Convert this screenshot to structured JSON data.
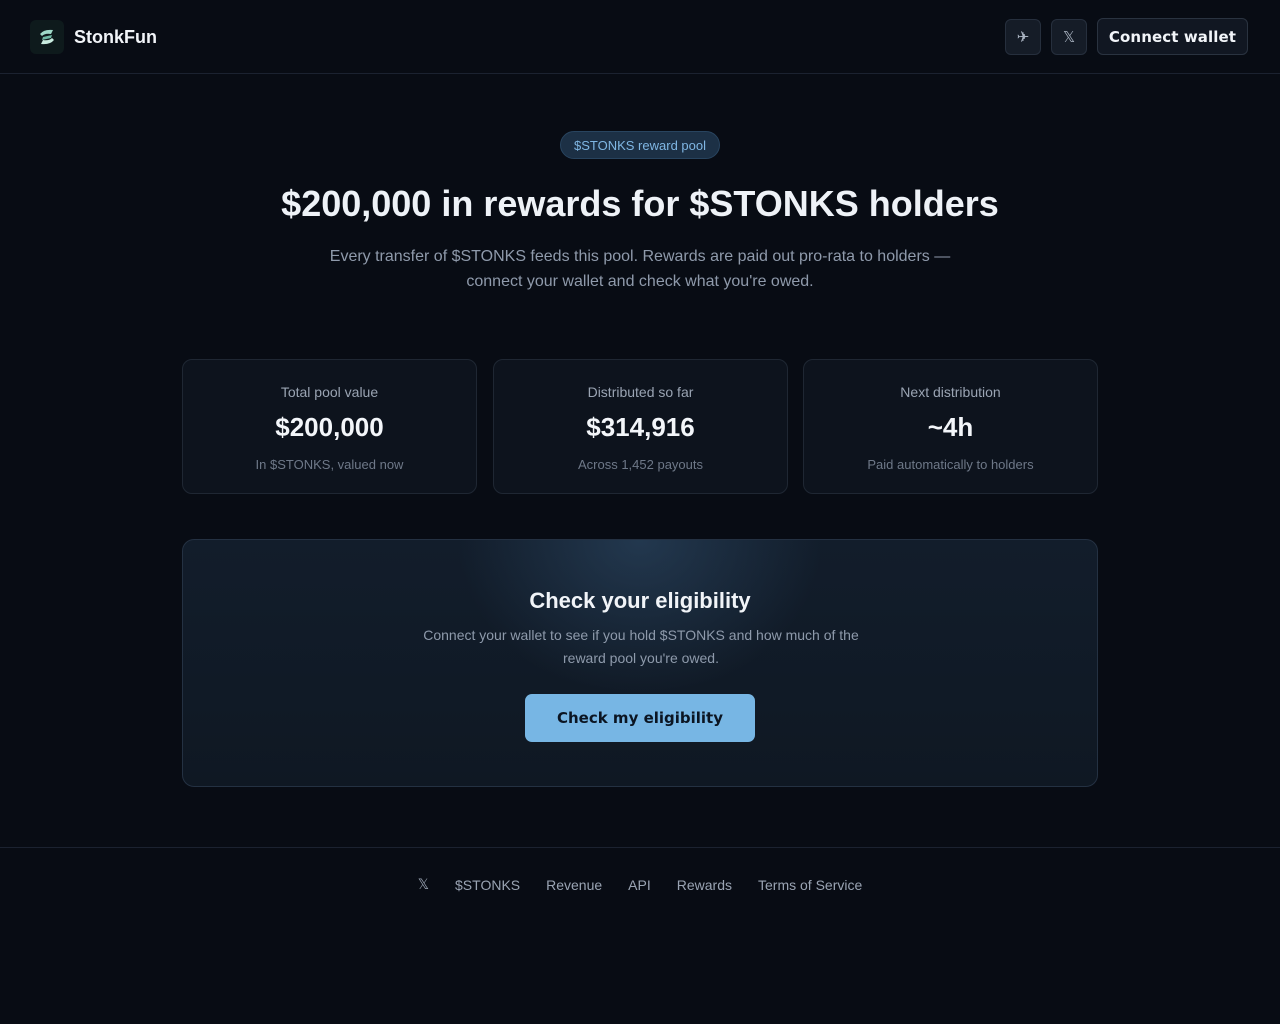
{
  "header": {
    "brand_name": "StonkFun",
    "logo_icon": "stonkfun-logo-icon",
    "telegram_icon": "✈",
    "x_icon": "𝕏",
    "connect_label": "Connect wallet"
  },
  "hero": {
    "pill_label": "$STONKS reward pool",
    "headline": "$200,000 in rewards for $STONKS holders",
    "subhead_line1": "Every transfer of $STONKS feeds this pool. Rewards are paid out pro-rata to holders —",
    "subhead_line2": "connect your wallet and check what you're owed."
  },
  "stats": [
    {
      "label": "Total pool value",
      "value": "$200,000",
      "note": "In $STONKS, valued now"
    },
    {
      "label": "Distributed so far",
      "value": "$314,916",
      "note": "Across 1,452 payouts"
    },
    {
      "label": "Next distribution",
      "value": "~4h",
      "note": "Paid automatically to holders"
    }
  ],
  "eligibility": {
    "title": "Check your eligibility",
    "desc_line1": "Connect your wallet to see if you hold $STONKS and how much of the",
    "desc_line2": "reward pool you're owed.",
    "button_label": "Check my eligibility"
  },
  "footer": {
    "x_icon": "𝕏",
    "links": [
      "$STONKS",
      "Revenue",
      "API",
      "Rewards",
      "Terms of Service"
    ]
  },
  "colors": {
    "background": "#080c14",
    "accent": "#77b6e4",
    "pill_text": "#7fb6e3"
  }
}
